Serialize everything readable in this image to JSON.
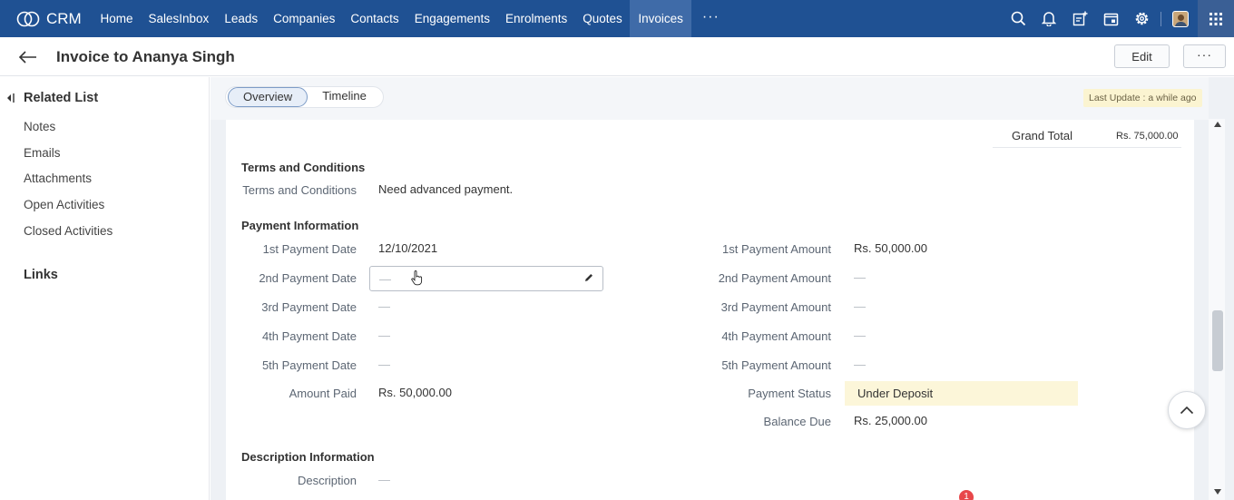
{
  "nav": {
    "logo_text": "CRM",
    "items": [
      "Home",
      "SalesInbox",
      "Leads",
      "Companies",
      "Contacts",
      "Engagements",
      "Enrolments",
      "Quotes",
      "Invoices"
    ],
    "active": "Invoices",
    "more": "···",
    "icons": [
      "search-icon",
      "bell-icon",
      "new-entry-icon",
      "calendar-icon",
      "gear-icon",
      "avatar",
      "apps-grid-icon"
    ]
  },
  "header": {
    "title": "Invoice to Ananya Singh",
    "edit_label": "Edit",
    "more_label": "···"
  },
  "sidebar": {
    "related_list_title": "Related List",
    "items": [
      "Notes",
      "Emails",
      "Attachments",
      "Open Activities",
      "Closed Activities"
    ],
    "links_title": "Links"
  },
  "tabs": {
    "overview": "Overview",
    "timeline": "Timeline",
    "active": "Overview"
  },
  "last_update": "Last Update : a while ago",
  "totals": {
    "grand_total_label": "Grand Total",
    "grand_total_value": "Rs. 75,000.00"
  },
  "terms": {
    "section_title": "Terms and Conditions",
    "label": "Terms and Conditions",
    "value": "Need advanced  payment."
  },
  "payment": {
    "section_title": "Payment Information",
    "left": [
      {
        "label": "1st Payment Date",
        "value": "12/10/2021"
      },
      {
        "label": "2nd Payment Date",
        "value": "—"
      },
      {
        "label": "3rd Payment Date",
        "value": "—"
      },
      {
        "label": "4th Payment Date",
        "value": "—"
      },
      {
        "label": "5th Payment Date",
        "value": "—"
      },
      {
        "label": "Amount Paid",
        "value": "Rs. 50,000.00"
      }
    ],
    "right": [
      {
        "label": "1st Payment Amount",
        "value": "Rs. 50,000.00"
      },
      {
        "label": "2nd Payment Amount",
        "value": "—"
      },
      {
        "label": "3rd Payment Amount",
        "value": "—"
      },
      {
        "label": "4th Payment Amount",
        "value": "—"
      },
      {
        "label": "5th Payment Amount",
        "value": "—"
      },
      {
        "label": "Payment Status",
        "value": "Under Deposit"
      },
      {
        "label": "Balance Due",
        "value": "Rs. 25,000.00"
      }
    ]
  },
  "description": {
    "section_title": "Description Information",
    "label": "Description",
    "value": "—"
  },
  "notification_count": "1",
  "colors": {
    "nav_bg": "#1f5193",
    "nav_active": "#3f6ba8",
    "status_highlight": "#fcf6d9"
  }
}
